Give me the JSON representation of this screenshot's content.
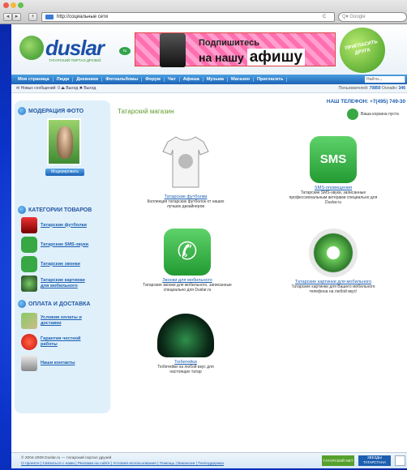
{
  "browser": {
    "url": "http://социальные сети",
    "search_placeholder": "Google",
    "reload": "c"
  },
  "header": {
    "logo_word": "duslar",
    "logo_ru": "ru",
    "logo_tag": "ТАТАРСКИЙ ПОРТАЛ ДРУЗЕЙ",
    "banner_line1": "Подпишитесь",
    "banner_line2a": "на нашу",
    "banner_line2b": "афишу",
    "invite": "ПРИГЛАСИТЬ ДРУГА"
  },
  "menu": {
    "items": [
      "Моя страница",
      "Люди",
      "Дневники",
      "Фотоальбомы",
      "Форум",
      "Чат",
      "Афиша",
      "Музыка",
      "Магазин",
      "Пригласить"
    ],
    "find": "Найти..."
  },
  "subbar": {
    "messages": "Новых сообщений: 0",
    "exit": "Выход",
    "exit2": "Выход",
    "users_label": "Пользователей:",
    "users_count": "70850",
    "online_label": "Онлайн:",
    "online_count": "346"
  },
  "left": {
    "moderation_title": "МОДЕРАЦИЯ ФОТО",
    "moderate_button": "Модерировать",
    "categories_title": "КАТЕГОРИИ ТОВАРОВ",
    "categories": [
      "Татарские футболки",
      "Татарские SMS-звуки",
      "Татарские звонки",
      "Татарские картинки для мобильного"
    ],
    "payment_title": "ОПЛАТА И ДОСТАВКА",
    "payment": [
      "Условия оплаты и доставки",
      "Гарантия честной работы",
      "Наши контакты"
    ]
  },
  "main": {
    "shop_title": "Татарский магазин",
    "phone": "НАШ ТЕЛЕФОН: +7(495) 749-30",
    "cart": "Ваша корзина пуста",
    "products": [
      {
        "name": "Татарские футболки",
        "desc": "Коллекция татарских футболок от наших лучших дизайнеров"
      },
      {
        "name": "SMS-оповещения",
        "desc": "Татарские SMS-звуки, записанные профессиональным актерами специально для Duslar.ru"
      },
      {
        "name": "Звонки для мобильного",
        "desc": "Татарские звонки для мобильного, записанные специально для Duslar.ru"
      },
      {
        "name": "Татарские картинки для мобильного",
        "desc": "Татарские картинки для Вашего мобильного телефона на любой вкус!"
      },
      {
        "name": "Тюбетейки",
        "desc": "Тюбетейки на любой вкус для настоящих татар"
      }
    ],
    "sms_label": "SMS"
  },
  "footer": {
    "copyright": "© 2004-2009 Duslar.ru — татарский портал друзей",
    "links": "О проекте | Связаться с нами | Реклама на сайте | Условия использования | Помощь | Вакансии | Техподдержка",
    "badge1": "ТАТАРСКИЙ NET",
    "badge2": "ЗВЕЗДЫ ТАТАРСТАНА"
  },
  "colors": {
    "accent": "#1d5fb0",
    "green": "#5e9b2a",
    "background": "#0a2fb8"
  }
}
